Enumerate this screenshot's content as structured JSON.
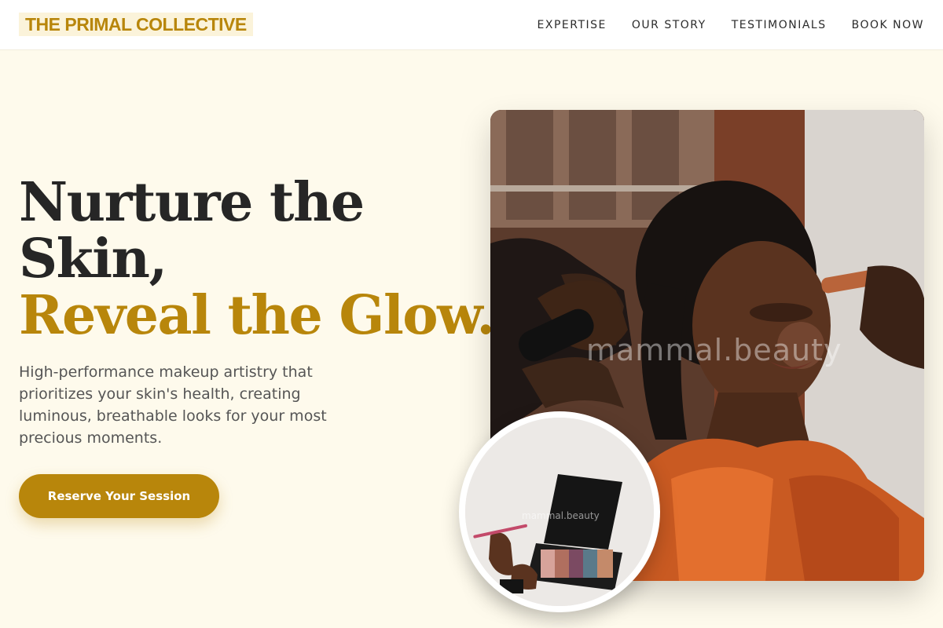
{
  "header": {
    "logo": "THE PRIMAL COLLECTIVE",
    "nav": [
      "EXPERTISE",
      "OUR STORY",
      "TESTIMONIALS",
      "BOOK NOW"
    ]
  },
  "hero": {
    "title_line1": "Nurture the",
    "title_line2": "Skin,",
    "title_accent": "Reveal the Glow.",
    "subtitle": "High-performance makeup artistry that prioritizes your skin's health, creating luminous, breathable looks for your most precious moments.",
    "cta_label": "Reserve Your Session"
  },
  "images": {
    "main_watermark": "mammal.beauty",
    "inset_watermark": "mammal.beauty"
  },
  "colors": {
    "accent": "#b8860b",
    "background": "#fefaec",
    "text": "#262626"
  }
}
